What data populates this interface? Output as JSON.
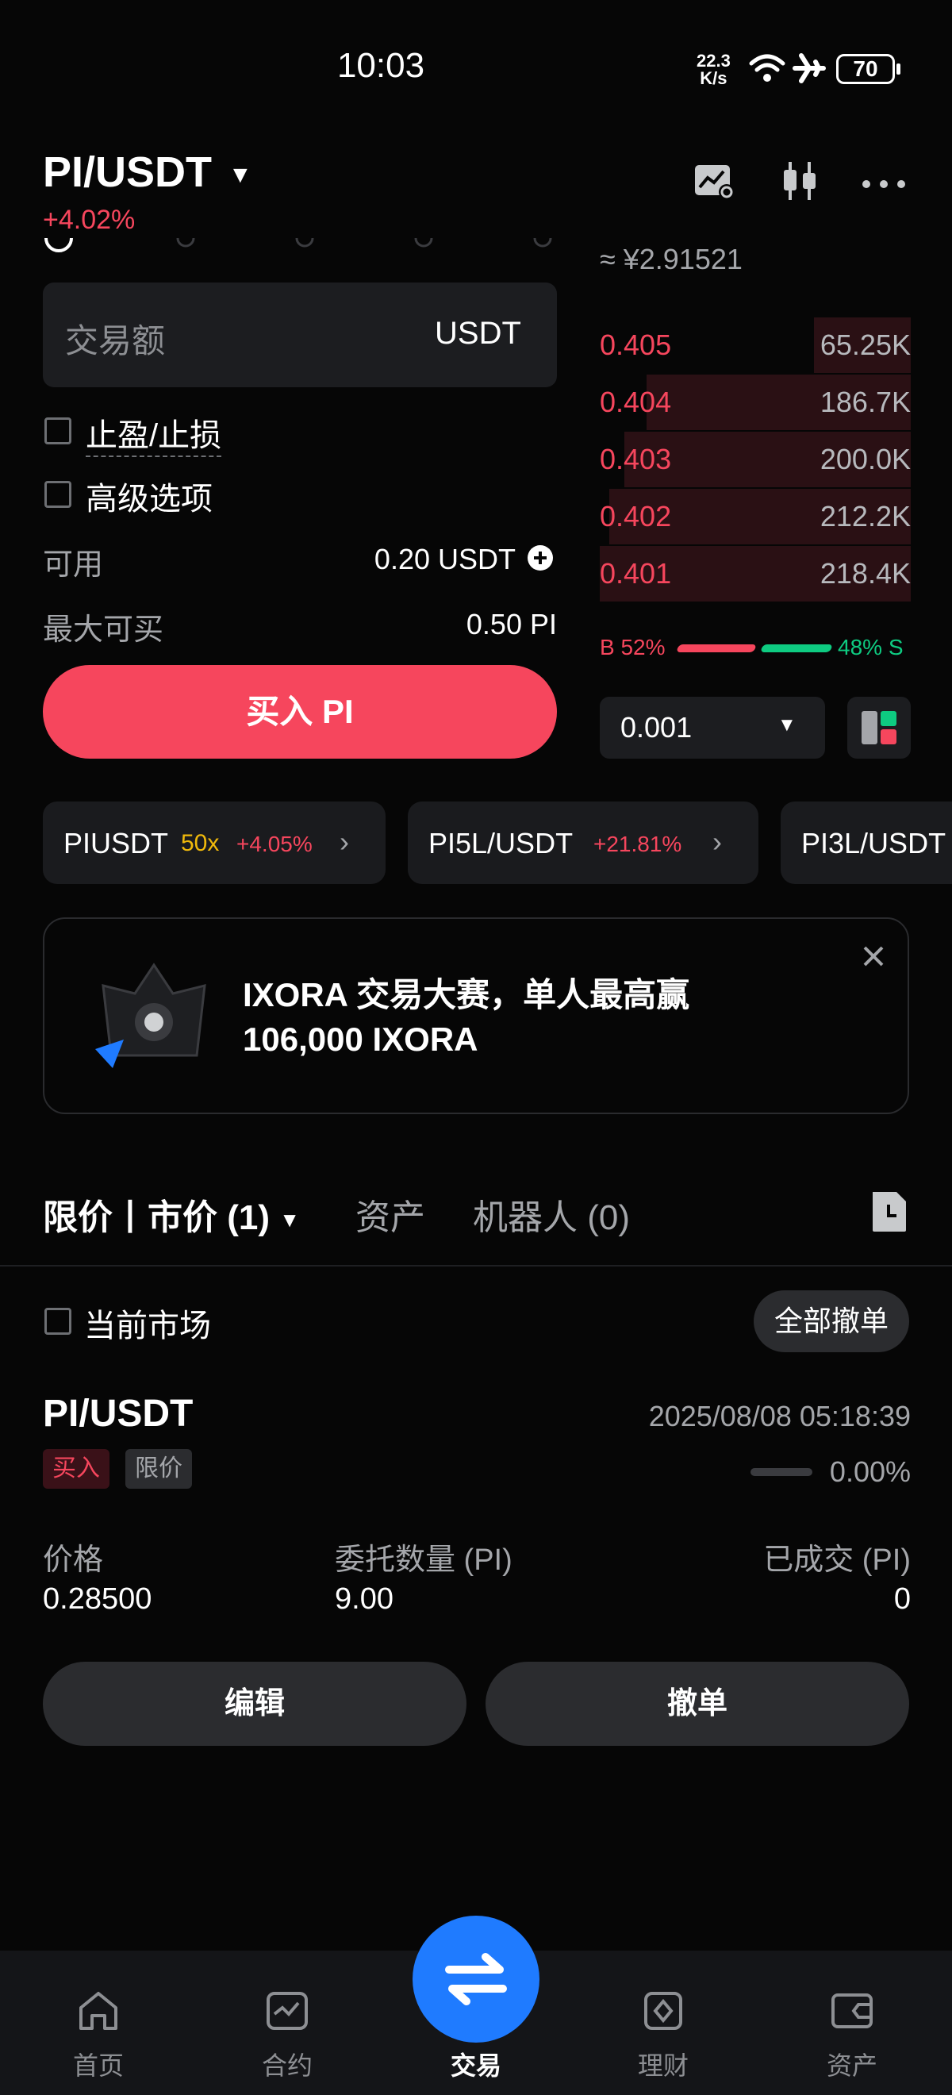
{
  "status_bar": {
    "time": "10:03",
    "net_speed_top": "22.3",
    "net_speed_bottom": "K/s",
    "battery": "70",
    "icons": [
      "wifi-icon",
      "airplane-icon",
      "battery-icon"
    ]
  },
  "header": {
    "pair": "PI/USDT",
    "change": "+4.02%",
    "icons": [
      "chart-settings-icon",
      "candlestick-icon",
      "more-icon"
    ]
  },
  "order_form": {
    "amount_placeholder": "交易额",
    "amount_unit": "USDT",
    "tp_sl_label": "止盈/止损",
    "advanced_label": "高级选项",
    "available_label": "可用",
    "available_value": "0.20 USDT",
    "max_buy_label": "最大可买",
    "max_buy_value": "0.50 PI",
    "buy_button": "买入 PI"
  },
  "order_book": {
    "cny_price": "≈ ¥2.91521",
    "asks": [
      {
        "price": "0.405",
        "qty": "65.25K",
        "depth": 0.31
      },
      {
        "price": "0.404",
        "qty": "186.7K",
        "depth": 0.85
      },
      {
        "price": "0.403",
        "qty": "200.0K",
        "depth": 0.92
      },
      {
        "price": "0.402",
        "qty": "212.2K",
        "depth": 0.97
      },
      {
        "price": "0.401",
        "qty": "218.4K",
        "depth": 1.0
      }
    ],
    "buy_ratio": "B 52%",
    "sell_ratio": "48% S",
    "depth_precision": "0.001"
  },
  "chips": [
    {
      "symbol": "PIUSDT",
      "leverage": "50x",
      "change": "+4.05%"
    },
    {
      "symbol": "PI5L/USDT",
      "leverage": "",
      "change": "+21.81%"
    },
    {
      "symbol": "PI3L/USDT",
      "leverage": "",
      "change": ""
    }
  ],
  "banner": {
    "line1": "IXORA 交易大赛，单人最高赢",
    "line2": "106,000 IXORA"
  },
  "tabs": {
    "limit_market": "限价丨市价 (1)",
    "assets": "资产",
    "robot": "机器人 (0)"
  },
  "filter": {
    "current_market": "当前市场",
    "cancel_all": "全部撤单"
  },
  "order": {
    "pair": "PI/USDT",
    "time": "2025/08/08 05:18:39",
    "side_tag": "买入",
    "type_tag": "限价",
    "fill_pct": "0.00%",
    "price_label": "价格",
    "price_value": "0.28500",
    "qty_label": "委托数量 (PI)",
    "qty_value": "9.00",
    "filled_label": "已成交 (PI)",
    "filled_value": "0",
    "edit_button": "编辑",
    "cancel_button": "撤单"
  },
  "bottom_nav": [
    {
      "label": "首页",
      "icon": "home-icon"
    },
    {
      "label": "合约",
      "icon": "futures-icon"
    },
    {
      "label": "交易",
      "icon": "swap-icon",
      "active": true
    },
    {
      "label": "理财",
      "icon": "earn-icon"
    },
    {
      "label": "资产",
      "icon": "wallet-icon"
    }
  ]
}
